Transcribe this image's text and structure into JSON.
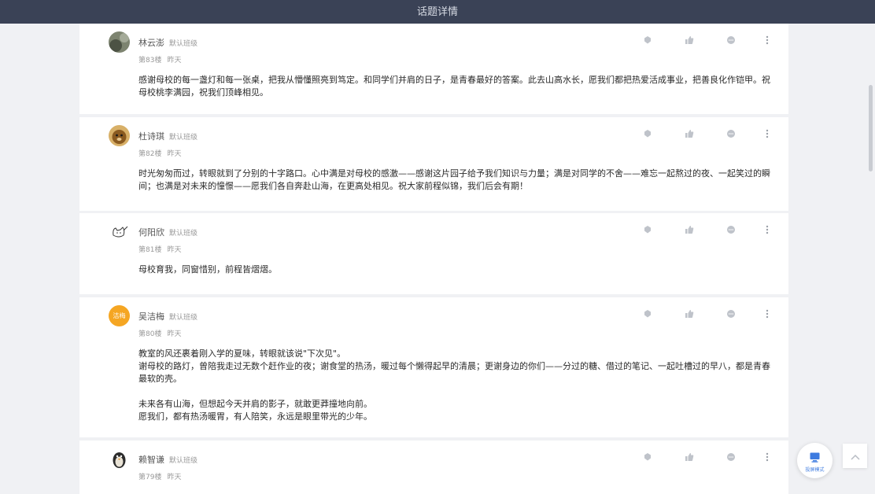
{
  "header": {
    "title": "话题详情"
  },
  "posts": [
    {
      "author": "林云澎",
      "class_label": "默认班级",
      "floor": "第83楼",
      "time": "昨天",
      "avatar_text": "",
      "content": "感谢母校的每一盏灯和每一张桌，把我从懵懂照亮到笃定。和同学们并肩的日子，是青春最好的答案。此去山高水长，愿我们都把热爱活成事业，把善良化作铠甲。祝母校桃李满园，祝我们顶峰相见。"
    },
    {
      "author": "杜诗琪",
      "class_label": "默认班级",
      "floor": "第82楼",
      "time": "昨天",
      "avatar_text": "",
      "content": "时光匆匆而过，转眼就到了分别的十字路口。心中满是对母校的感激——感谢这片园子给予我们知识与力量；满是对同学的不舍——难忘一起熬过的夜、一起笑过的瞬间；也满是对未来的憧憬——愿我们各自奔赴山海，在更高处相见。祝大家前程似锦，我们后会有期！"
    },
    {
      "author": "何阳欣",
      "class_label": "默认班级",
      "floor": "第81楼",
      "time": "昨天",
      "avatar_text": "",
      "content": "母校育我，同窗惜别，前程皆熠熠。"
    },
    {
      "author": "吴洁梅",
      "class_label": "默认班级",
      "floor": "第80楼",
      "time": "昨天",
      "avatar_text": "洁梅",
      "content": "教室的风还裹着刚入学的夏味，转眼就该说\"下次见\"。\n谢母校的路灯，曾陪我走过无数个赶作业的夜；谢食堂的热汤，暖过每个懒得起早的清晨；更谢身边的你们——分过的糖、借过的笔记、一起吐槽过的早八，都是青春最软的壳。\n\n未来各有山海，但想起今天并肩的影子，就敢更莽撞地向前。\n愿我们，都有热汤暖胃，有人陪笑，永远是眼里带光的少年。"
    },
    {
      "author": "赖智谦",
      "class_label": "默认班级",
      "floor": "第79楼",
      "time": "昨天",
      "avatar_text": "",
      "content": ""
    }
  ],
  "float_button": {
    "label": "投屏模式",
    "icon": "screen-cast-icon"
  },
  "back_to_top": {
    "icon": "chevron-up-icon"
  },
  "colors": {
    "header_bg": "#3a4256",
    "accent": "#f5a623",
    "float_icon": "#3d7be0"
  }
}
